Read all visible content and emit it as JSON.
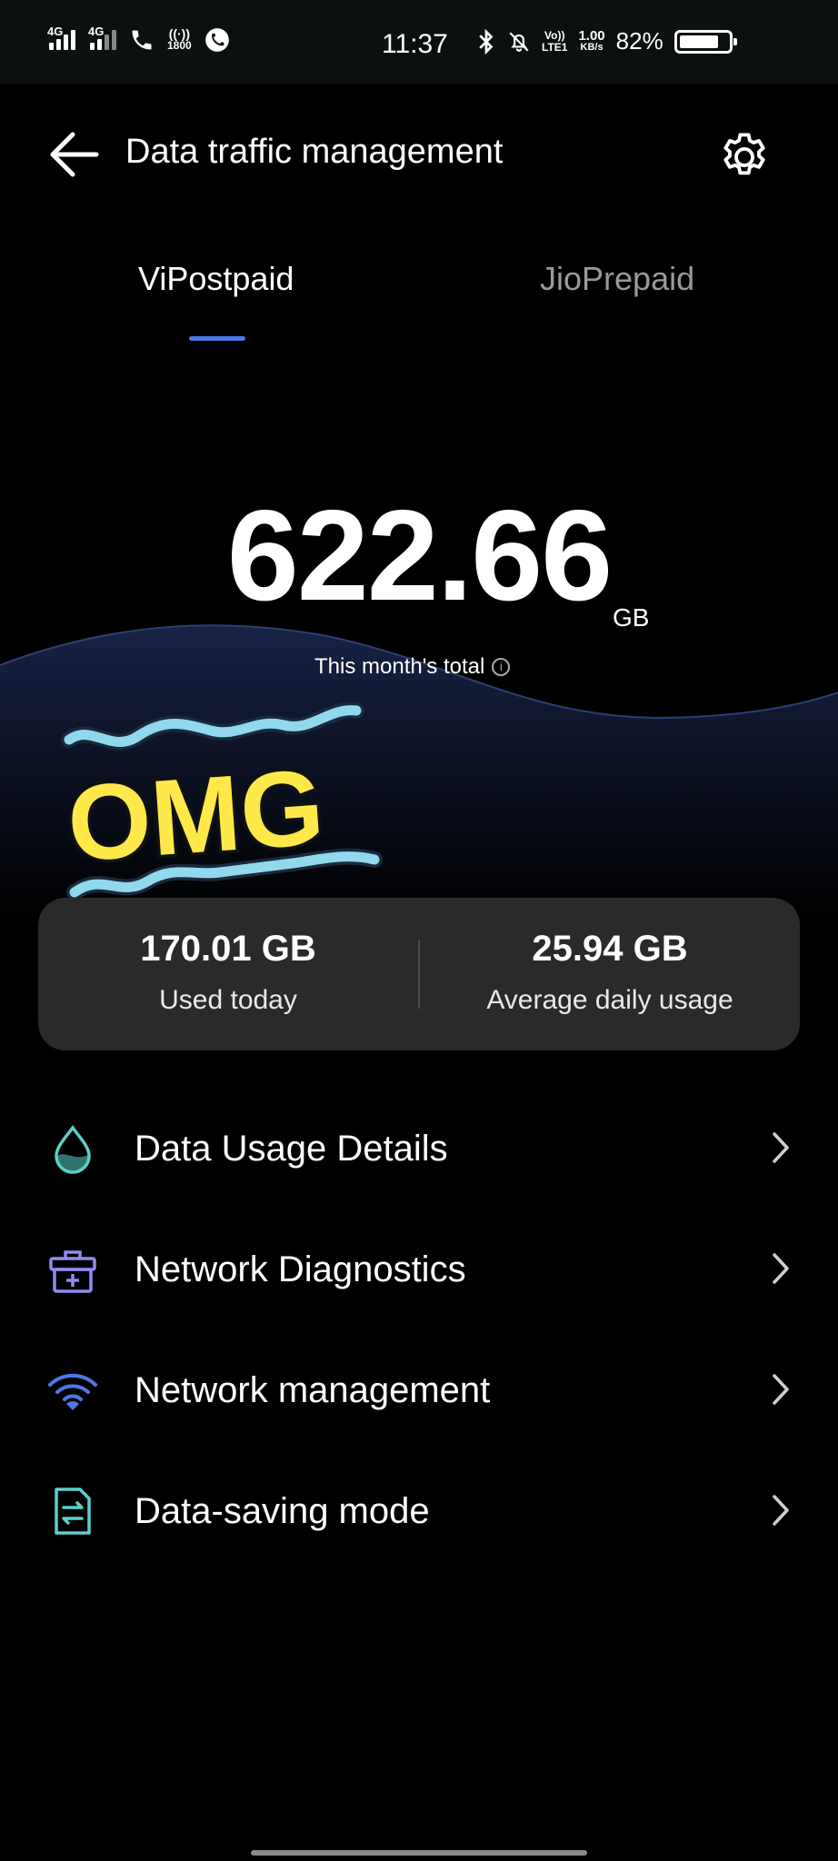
{
  "status_bar": {
    "sim1_tag": "4G",
    "sim2_tag": "4G",
    "hd_label": "1800",
    "time": "11:37",
    "volte_top": "Vo))",
    "volte_bottom": "LTE1",
    "speed_value": "1.00",
    "speed_unit": "KB/s",
    "battery_percent": "82%",
    "battery_level": 0.82
  },
  "header": {
    "title": "Data traffic management"
  },
  "tabs": [
    {
      "label": "ViPostpaid",
      "selected": true
    },
    {
      "label": "JioPrepaid",
      "selected": false
    }
  ],
  "usage": {
    "total_value": "622.66",
    "total_unit": "GB",
    "total_caption": "This month's total",
    "info_glyph": "i"
  },
  "sticker": {
    "text": "OMG"
  },
  "stats": {
    "used_today_value": "170.01 GB",
    "used_today_label": "Used today",
    "avg_daily_value": "25.94 GB",
    "avg_daily_label": "Average daily usage"
  },
  "menu": [
    {
      "label": "Data Usage Details",
      "icon": "droplet-icon",
      "color": "#5bd0c8"
    },
    {
      "label": "Network Diagnostics",
      "icon": "toolbox-icon",
      "color": "#8f8cf0"
    },
    {
      "label": "Network management",
      "icon": "wifi-icon",
      "color": "#4d78e8"
    },
    {
      "label": "Data-saving mode",
      "icon": "data-saver-icon",
      "color": "#5bd0c8"
    }
  ],
  "colors": {
    "accent": "#4d78e8",
    "sticker_yellow": "#ffe94a",
    "sticker_wave": "#8fd8ee"
  }
}
